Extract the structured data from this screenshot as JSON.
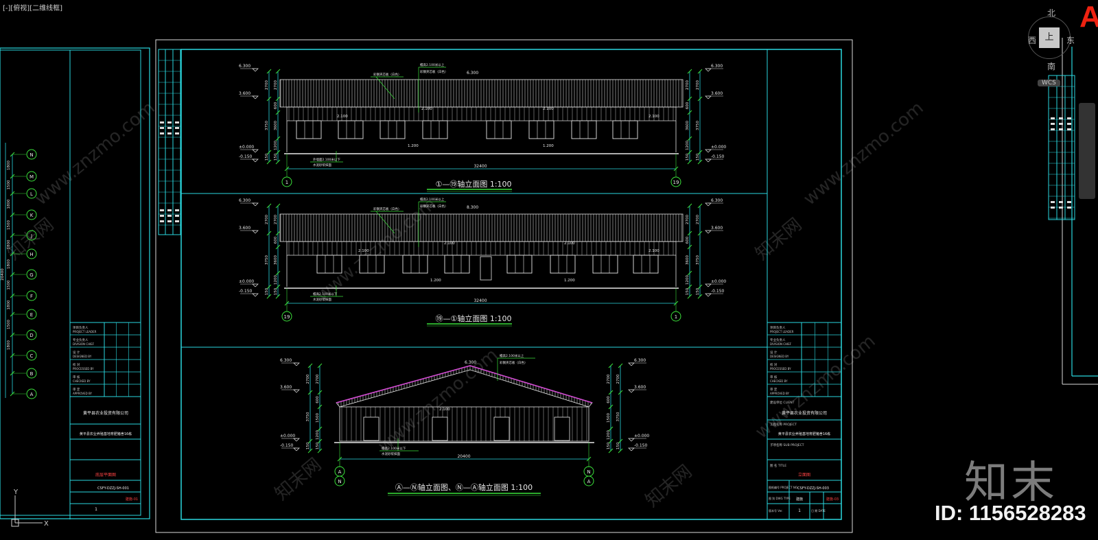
{
  "viewport": {
    "label": "[-][俯视][二维线框]"
  },
  "viewcube": {
    "north": "北",
    "west": "西",
    "east": "东",
    "south": "南",
    "face": "上",
    "wcs": "WCS"
  },
  "brand": {
    "logo_text": "知末",
    "id_text": "ID: 1156528283",
    "corner_letter": "A",
    "watermark": "www.znzmo.com",
    "watermark_cn": "知末网"
  },
  "elevations": {
    "top": {
      "title": "①—⑲轴立面图 1:100",
      "left_axis": "1",
      "right_axis": "19",
      "total": "32400",
      "note_roof": "檐高2.100米以上",
      "note_roof2": "彩钢夹芯板（白色）",
      "note_wall": "砖墙（涂料）",
      "note_base": "外墙面2.100米以下",
      "note_base2": "水泥砂浆抹面",
      "win_label": "2.100",
      "sill": "1.200",
      "ridge": "6.300"
    },
    "mid": {
      "title": "⑲—①轴立面图 1:100",
      "left_axis": "19",
      "right_axis": "1",
      "total": "32400",
      "ridge": "8.300",
      "note_roof": "檐高2.100米以上",
      "note_roof2": "彩钢夹芯板（白色）",
      "note_base": "檐高2.100米以下",
      "note_base2": "水泥砂浆抹面",
      "win_label": "2.100",
      "sill": "1.200"
    },
    "bottom": {
      "title": "Ⓐ—Ⓝ轴立面图、Ⓝ—Ⓐ轴立面图 1:100",
      "left_axis_top": "A",
      "left_axis_bottom": "N",
      "right_axis_top": "N",
      "right_axis_bottom": "A",
      "total": "20400",
      "ridge": "6.300",
      "note_roof": "檐高2.100米以上",
      "note_roof2": "彩钢夹芯板（白色）",
      "note_base": "檐高2.100米以下",
      "note_base2": "水泥砂浆抹面",
      "door_label": "2.100"
    }
  },
  "levels": {
    "l63": "6.300",
    "l36": "3.600",
    "l0": "±0.000",
    "lm": "-0.150"
  },
  "dims": {
    "d2700": "2700",
    "d3600": "3600",
    "d3750": "3750",
    "d1500": "1500",
    "d1200": "1200",
    "d150": "150",
    "d600": "600"
  },
  "left_plan": {
    "axes": [
      "N",
      "M",
      "L",
      "K",
      "J",
      "H",
      "G",
      "F",
      "E",
      "D",
      "C",
      "B",
      "A"
    ],
    "spacings": [
      "1800",
      "1500",
      "1800",
      "1500",
      "1800",
      "1800",
      "1500",
      "1800",
      "1500",
      "1800"
    ],
    "total": "20400"
  },
  "title_block_right": {
    "rows": [
      {
        "cn": "项目负责人",
        "en": "PROJECT LEADER"
      },
      {
        "cn": "专业负责人",
        "en": "DIVISION CHIEF"
      },
      {
        "cn": "设 计",
        "en": "DESIGNED BY"
      },
      {
        "cn": "校 对",
        "en": "PROCESSED BY"
      },
      {
        "cn": "审 核",
        "en": "CHECKED BY"
      },
      {
        "cn": "审 定",
        "en": "APPROVED BY"
      }
    ],
    "client_label": "建设单位 CLIENT",
    "client": "黄平县农业投资有限公司",
    "project_label": "工程名称 PROJECT",
    "project": "黄平县农业养殖基地育肥猪舍16栋",
    "sub_label": "子项名称 SUB PROJECT",
    "title_label": "图 名 TITLE",
    "title": "立面图",
    "drawing_no": "CSFY-DZZJ-SH-003",
    "drawing_no_label": "图纸编号 PROJECT NO.",
    "type_label": "图 别 DWG TYPE",
    "type_value": "建施",
    "scale_value": "建施-03",
    "ver_label": "版本号 Ver.",
    "ver_value": "1",
    "date_label": "日 期 DATE"
  },
  "title_block_left": {
    "client": "黄平县农业投资有限公司",
    "project": "黄平县农业养殖基地育肥猪舍16栋",
    "title": "底层平面图",
    "drawing_no": "CSFY-DZZJ-SH-001",
    "scale_value": "建施-01",
    "ver_value": "1"
  },
  "ucs": {
    "y": "Y",
    "x": "X"
  }
}
